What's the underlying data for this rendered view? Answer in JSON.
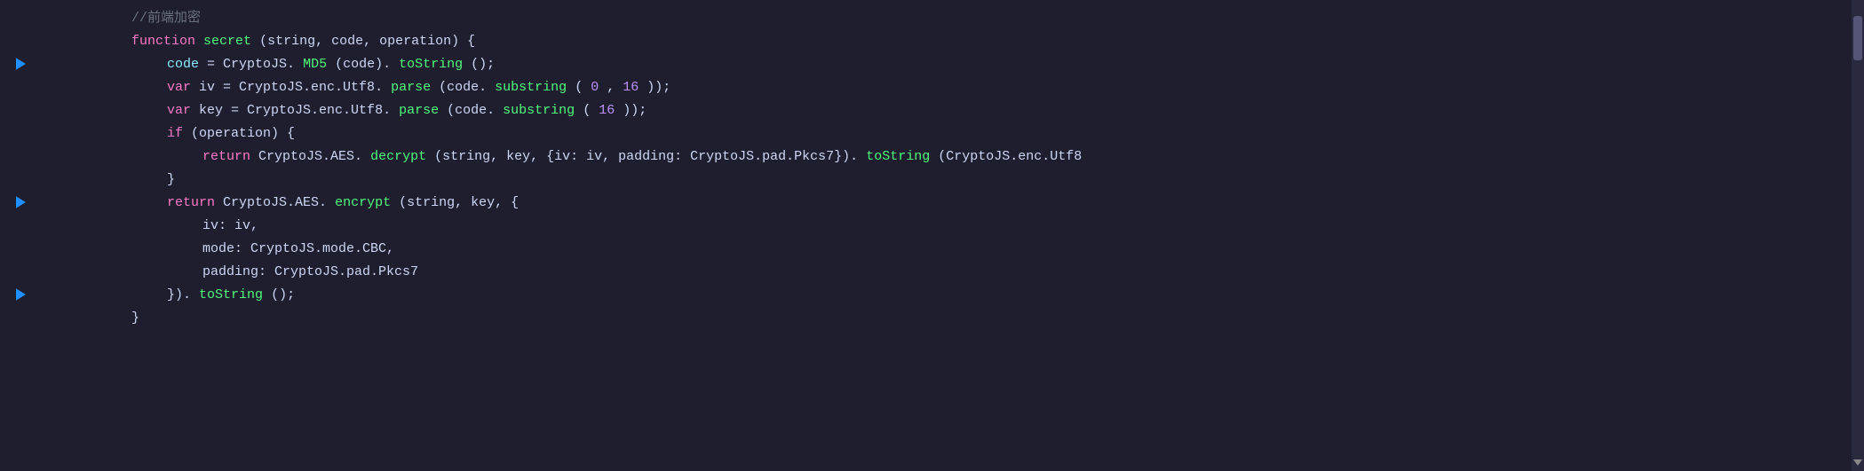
{
  "editor": {
    "lines": [
      {
        "id": 1,
        "has_breakpoint": false,
        "indent": 0,
        "tokens": [
          {
            "type": "comment",
            "text": "//前端加密"
          }
        ]
      },
      {
        "id": 2,
        "has_breakpoint": false,
        "indent": 0,
        "tokens": [
          {
            "type": "keyword",
            "text": "function"
          },
          {
            "type": "plain",
            "text": " "
          },
          {
            "type": "func",
            "text": "secret"
          },
          {
            "type": "plain",
            "text": "(string, code, operation) {"
          }
        ]
      },
      {
        "id": 3,
        "has_breakpoint": true,
        "indent": 1,
        "tokens": [
          {
            "type": "cyan",
            "text": "code"
          },
          {
            "type": "plain",
            "text": " = CryptoJS."
          },
          {
            "type": "method",
            "text": "MD5"
          },
          {
            "type": "plain",
            "text": "(code)."
          },
          {
            "type": "method",
            "text": "toString"
          },
          {
            "type": "plain",
            "text": "();"
          }
        ]
      },
      {
        "id": 4,
        "has_breakpoint": false,
        "indent": 1,
        "tokens": [
          {
            "type": "keyword",
            "text": "var"
          },
          {
            "type": "plain",
            "text": " iv = CryptoJS.enc.Utf8."
          },
          {
            "type": "method",
            "text": "parse"
          },
          {
            "type": "plain",
            "text": "(code."
          },
          {
            "type": "method",
            "text": "substring"
          },
          {
            "type": "plain",
            "text": "("
          },
          {
            "type": "number",
            "text": "0"
          },
          {
            "type": "plain",
            "text": ", "
          },
          {
            "type": "number",
            "text": "16"
          },
          {
            "type": "plain",
            "text": "));"
          }
        ]
      },
      {
        "id": 5,
        "has_breakpoint": false,
        "indent": 1,
        "tokens": [
          {
            "type": "keyword",
            "text": "var"
          },
          {
            "type": "plain",
            "text": " key = CryptoJS.enc.Utf8."
          },
          {
            "type": "method",
            "text": "parse"
          },
          {
            "type": "plain",
            "text": "(code."
          },
          {
            "type": "method",
            "text": "substring"
          },
          {
            "type": "plain",
            "text": "("
          },
          {
            "type": "number",
            "text": "16"
          },
          {
            "type": "plain",
            "text": "));"
          }
        ]
      },
      {
        "id": 6,
        "has_breakpoint": false,
        "indent": 1,
        "tokens": [
          {
            "type": "keyword",
            "text": "if"
          },
          {
            "type": "plain",
            "text": " (operation) {"
          }
        ]
      },
      {
        "id": 7,
        "has_breakpoint": false,
        "indent": 2,
        "tokens": [
          {
            "type": "keyword",
            "text": "return"
          },
          {
            "type": "plain",
            "text": " CryptoJS.AES."
          },
          {
            "type": "method",
            "text": "decrypt"
          },
          {
            "type": "plain",
            "text": "(string, key, {iv: iv, padding: CryptoJS.pad.Pkcs7})."
          },
          {
            "type": "method",
            "text": "toString"
          },
          {
            "type": "plain",
            "text": "(CryptoJS.enc.Utf8"
          }
        ]
      },
      {
        "id": 8,
        "has_breakpoint": false,
        "indent": 1,
        "tokens": [
          {
            "type": "plain",
            "text": "}"
          }
        ]
      },
      {
        "id": 9,
        "has_breakpoint": true,
        "indent": 1,
        "tokens": [
          {
            "type": "keyword",
            "text": "return"
          },
          {
            "type": "plain",
            "text": " CryptoJS.AES."
          },
          {
            "type": "method",
            "text": "encrypt"
          },
          {
            "type": "plain",
            "text": "(string, key, {"
          }
        ]
      },
      {
        "id": 10,
        "has_breakpoint": false,
        "indent": 2,
        "tokens": [
          {
            "type": "plain",
            "text": "iv: iv,"
          }
        ]
      },
      {
        "id": 11,
        "has_breakpoint": false,
        "indent": 2,
        "tokens": [
          {
            "type": "plain",
            "text": "mode: CryptoJS.mode.CBC,"
          }
        ]
      },
      {
        "id": 12,
        "has_breakpoint": false,
        "indent": 2,
        "tokens": [
          {
            "type": "plain",
            "text": "padding: CryptoJS.pad.Pkcs7"
          }
        ]
      },
      {
        "id": 13,
        "has_breakpoint": true,
        "indent": 1,
        "tokens": [
          {
            "type": "plain",
            "text": "})."
          },
          {
            "type": "method",
            "text": "toString"
          },
          {
            "type": "plain",
            "text": "();"
          }
        ]
      },
      {
        "id": 14,
        "has_breakpoint": false,
        "indent": 0,
        "tokens": [
          {
            "type": "plain",
            "text": "}"
          }
        ]
      }
    ],
    "breakpoint_lines": [
      3,
      9,
      13
    ]
  },
  "colors": {
    "bg": "#1e1e2e",
    "comment": "#6c9b6c",
    "keyword": "#ff79c6",
    "func": "#50fa7b",
    "method": "#50fa7b",
    "cyan": "#8be9fd",
    "number": "#bd93f9",
    "plain": "#cdd6f4",
    "breakpoint": "#1e90ff"
  }
}
